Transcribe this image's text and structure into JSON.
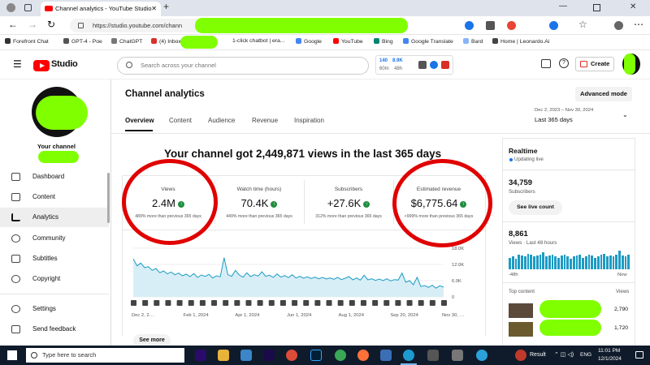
{
  "browser": {
    "tab_title": "Channel analytics - YouTube Studio",
    "url": "https://studio.youtube.com/chann",
    "bookmarks": [
      "Forefront Chat",
      "GPT-4 - Poe",
      "ChatGPT",
      "(4) Inbox",
      "1-click chatbot | era...",
      "Google",
      "YouTube",
      "Bing",
      "Google Translate",
      "Bard",
      "Home | Leonardo.Ai"
    ]
  },
  "header": {
    "logo_text": "Studio",
    "search_placeholder": "Search across your channel",
    "ext_numbers": [
      "140",
      "8.9K",
      "60m",
      "48h"
    ],
    "create_label": "Create"
  },
  "sidebar": {
    "channel_label": "Your channel",
    "items": [
      {
        "label": "Dashboard",
        "icon": "dashboard-icon"
      },
      {
        "label": "Content",
        "icon": "content-icon"
      },
      {
        "label": "Analytics",
        "icon": "analytics-icon",
        "active": true
      },
      {
        "label": "Community",
        "icon": "community-icon"
      },
      {
        "label": "Subtitles",
        "icon": "subtitles-icon"
      },
      {
        "label": "Copyright",
        "icon": "copyright-icon"
      },
      {
        "label": "Settings",
        "icon": "gear-icon"
      },
      {
        "label": "Send feedback",
        "icon": "feedback-icon"
      }
    ]
  },
  "main": {
    "page_title": "Channel analytics",
    "advanced_mode": "Advanced mode",
    "tabs": [
      "Overview",
      "Content",
      "Audience",
      "Revenue",
      "Inspiration"
    ],
    "active_tab": "Overview",
    "date_range": "Dec 2, 2023 – Nov 30, 2024",
    "period": "Last 365 days",
    "headline": "Your channel got 2,449,871 views in the last 365 days",
    "metrics": [
      {
        "label": "Views",
        "value": "2.4M",
        "change": "489% more than previous 365 days"
      },
      {
        "label": "Watch time (hours)",
        "value": "70.4K",
        "change": "449% more than previous 365 days"
      },
      {
        "label": "Subscribers",
        "value": "+27.6K",
        "change": "312% more than previous 365 days"
      },
      {
        "label": "Estimated revenue",
        "value": "$6,775.64",
        "change": ">999% more than previous 365 days"
      }
    ],
    "see_more": "See more"
  },
  "chart_data": {
    "type": "area",
    "x_ticks": [
      "Dec 2, 2…",
      "Feb 1, 2024",
      "Apr 1, 2024",
      "Jun 1, 2024",
      "Aug 1, 2024",
      "Sep 20, 2024",
      "Nov 30, …"
    ],
    "y_ticks": [
      "0",
      "6.0K",
      "12.0K",
      "18.0K"
    ],
    "ylim": [
      0,
      18000
    ],
    "values": [
      14000,
      11500,
      12500,
      10800,
      11200,
      9800,
      10500,
      8900,
      9600,
      8500,
      9200,
      8200,
      8800,
      7800,
      8400,
      7500,
      8600,
      7200,
      8100,
      7600,
      8300,
      7000,
      7800,
      7400,
      14500,
      8200,
      7600,
      9800,
      8100,
      7300,
      8900,
      7500,
      8200,
      7700,
      9300,
      7600,
      8000,
      7200,
      8500,
      7300,
      7900,
      7100,
      8200,
      7000,
      7600,
      6900,
      7400,
      6800,
      7300,
      6700,
      7200,
      6600,
      7000,
      6500,
      7200,
      6400,
      6900,
      7500,
      6300,
      7000,
      6200,
      8000,
      6300,
      6700,
      6100,
      6600,
      6000,
      6700,
      5900,
      6400,
      6200,
      8800,
      5400,
      6000,
      4500,
      7200,
      3800,
      4200,
      3500,
      4300,
      3200,
      4100,
      3600
    ]
  },
  "realtime": {
    "title": "Realtime",
    "status": "Updating live",
    "subs_value": "34,759",
    "subs_label": "Subscribers",
    "see_live": "See live count",
    "views_value": "8,861",
    "views_label": "Views · Last 48 hours",
    "axis_left": "-48h",
    "axis_right": "Now",
    "bars": [
      0.55,
      0.6,
      0.5,
      0.7,
      0.65,
      0.6,
      0.75,
      0.7,
      0.6,
      0.65,
      0.7,
      0.8,
      0.6,
      0.65,
      0.7,
      0.6,
      0.55,
      0.65,
      0.7,
      0.6,
      0.5,
      0.6,
      0.65,
      0.7,
      0.55,
      0.6,
      0.7,
      0.65,
      0.55,
      0.6,
      0.7,
      0.75,
      0.6,
      0.65,
      0.6,
      0.7,
      0.9,
      0.65,
      0.6,
      0.7
    ],
    "top_content_label": "Top content",
    "views_col": "Views",
    "top_content": [
      {
        "views": "2,790"
      },
      {
        "views": "1,720"
      }
    ]
  },
  "taskbar": {
    "search_placeholder": "Type here to search",
    "weather": "Result",
    "lang": "ENG",
    "time": "11:01 PM",
    "date": "12/1/2024"
  }
}
